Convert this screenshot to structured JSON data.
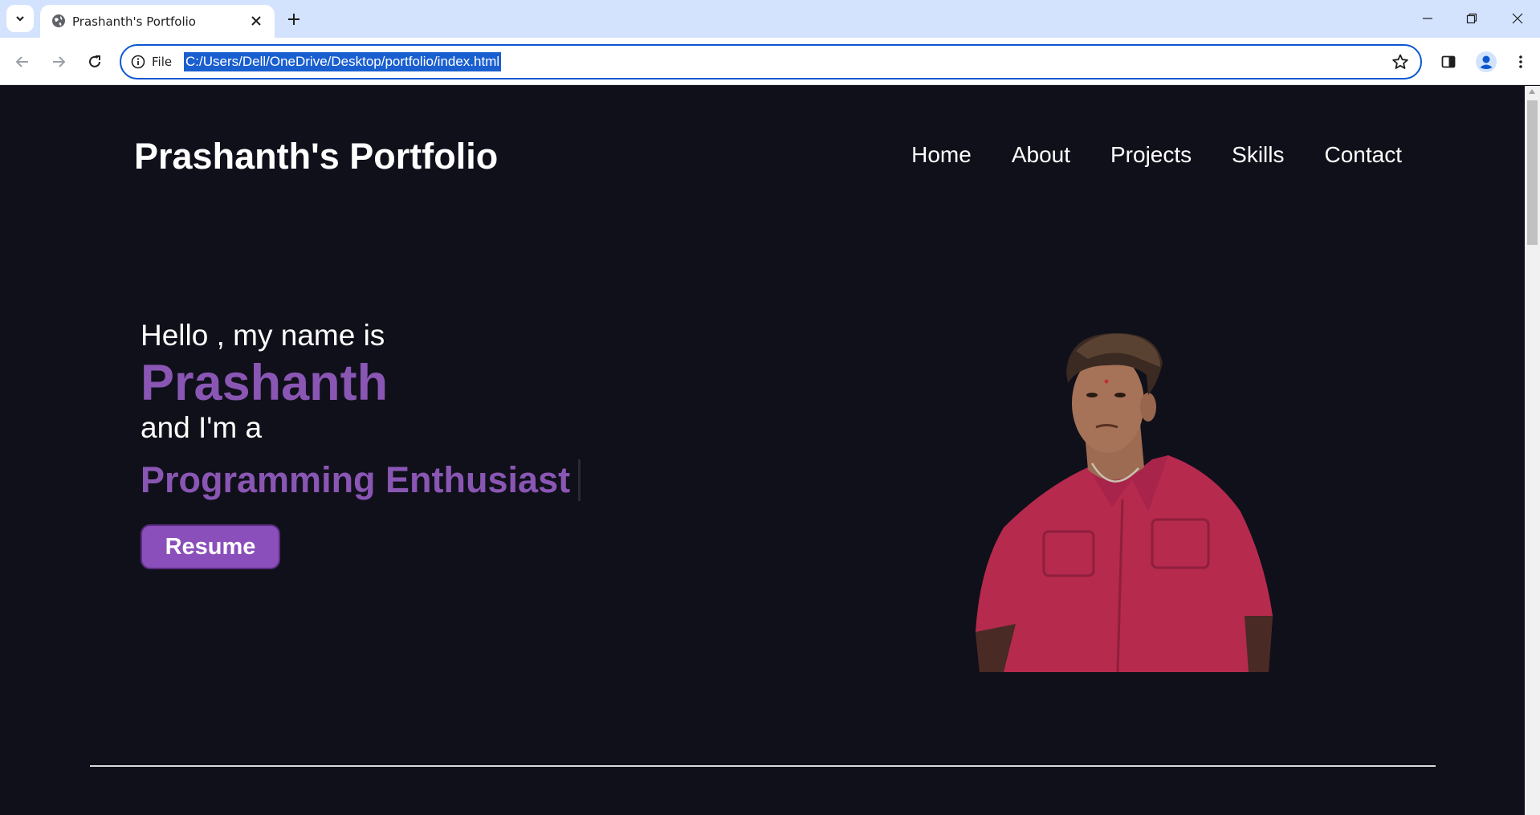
{
  "browser": {
    "tab_title": "Prashanth's Portfolio",
    "site_info_label": "File",
    "url": "C:/Users/Dell/OneDrive/Desktop/portfolio/index.html",
    "accent_color": "#0b57d0"
  },
  "page": {
    "logo": "Prashanth's Portfolio",
    "nav": [
      "Home",
      "About",
      "Projects",
      "Skills",
      "Contact"
    ],
    "hero": {
      "greeting": "Hello , my name is",
      "name": "Prashanth",
      "intro": "and I'm a",
      "role": "Programming Enthusiast",
      "button": "Resume"
    },
    "colors": {
      "background": "#10101a",
      "accent": "#8a56b4",
      "text": "#ffffff"
    }
  }
}
